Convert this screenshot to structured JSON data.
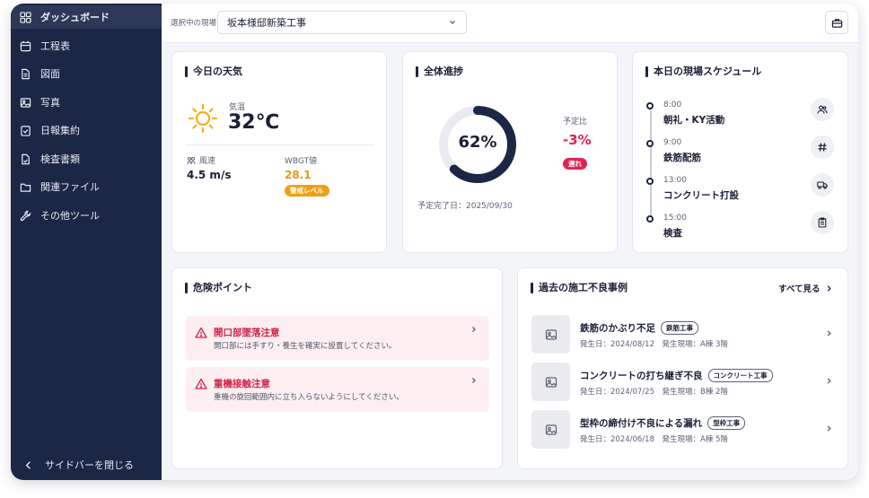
{
  "sidebar": {
    "items": [
      {
        "label": "ダッシュボード",
        "icon": "dashboard-icon",
        "active": true
      },
      {
        "label": "工程表",
        "icon": "calendar-icon"
      },
      {
        "label": "図面",
        "icon": "document-icon"
      },
      {
        "label": "写真",
        "icon": "image-icon"
      },
      {
        "label": "日報集約",
        "icon": "clipboard-check-icon"
      },
      {
        "label": "検査書類",
        "icon": "file-icon"
      },
      {
        "label": "関連ファイル",
        "icon": "folder-icon"
      },
      {
        "label": "その他ツール",
        "icon": "wrench-icon"
      }
    ],
    "collapse_label": "サイドバーを閉じる"
  },
  "topbar": {
    "site_label": "選択中の現場",
    "site_value": "坂本様邸新築工事"
  },
  "weather": {
    "title": "今日の天気",
    "temp_label": "気温",
    "temp_value": "32℃",
    "wind_label": "風速",
    "wind_value": "4.5 m/s",
    "wbgt_label": "WBGT値",
    "wbgt_value": "28.1",
    "wbgt_badge": "警戒レベル"
  },
  "progress": {
    "title": "全体進捗",
    "percent": 62,
    "percent_text": "62%",
    "plan_label": "予定比",
    "plan_value": "-3%",
    "delay_badge": "遅れ",
    "finish_date": "予定完了日：2025/09/30"
  },
  "schedule": {
    "title": "本日の現場スケジュール",
    "items": [
      {
        "time": "8:00",
        "task": "朝礼・KY活動",
        "icon": "people-icon"
      },
      {
        "time": "9:00",
        "task": "鉄筋配筋",
        "icon": "hash-icon"
      },
      {
        "time": "13:00",
        "task": "コンクリート打設",
        "icon": "truck-icon"
      },
      {
        "time": "15:00",
        "task": "検査",
        "icon": "clipboard-icon"
      }
    ]
  },
  "danger": {
    "title": "危険ポイント",
    "items": [
      {
        "title": "開口部墜落注意",
        "desc": "開口部には手すり・養生を確実に設置してください。"
      },
      {
        "title": "重機接触注意",
        "desc": "重機の旋回範囲内に立ち入らないようにしてください。"
      }
    ]
  },
  "defects": {
    "title": "過去の施工不良事例",
    "see_all": "すべて見る",
    "items": [
      {
        "title": "鉄筋のかぶり不足",
        "tag": "鉄筋工事",
        "meta": "発生日：2024/08/12　発生現場：A棟 3階"
      },
      {
        "title": "コンクリートの打ち継ぎ不良",
        "tag": "コンクリート工事",
        "meta": "発生日：2024/07/25　発生現場：B棟 2階"
      },
      {
        "title": "型枠の締付け不良による漏れ",
        "tag": "型枠工事",
        "meta": "発生日：2024/06/18　発生現場：A棟 5階"
      }
    ]
  },
  "colors": {
    "sidebar_bg": "#1c2645",
    "danger": "#e0244f",
    "warning": "#eea112",
    "progress_ring": "#1c2645"
  }
}
